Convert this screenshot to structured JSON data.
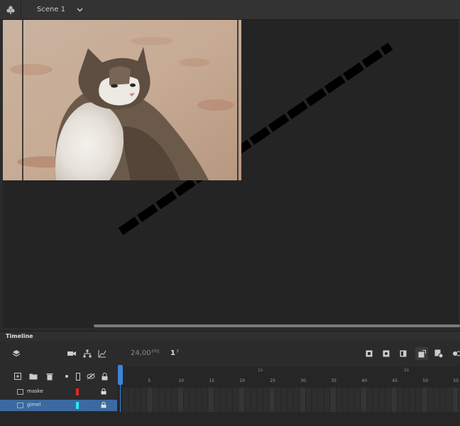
{
  "topbar": {
    "scene_label": "Scene 1"
  },
  "timeline": {
    "title": "Timeline",
    "fps_value": "24,00",
    "fps_unit": "FPS",
    "frame_value": "1",
    "frame_unit": "F",
    "second_markers": [
      "1s",
      "2s"
    ],
    "frame_ticks": [
      "5",
      "10",
      "15",
      "20",
      "25",
      "30",
      "35",
      "40",
      "45",
      "50",
      "55"
    ]
  },
  "layers": [
    {
      "name": "maske",
      "color": "#e3262a",
      "selected": false
    },
    {
      "name": "gimel",
      "color": "#2ee6f0",
      "selected": true
    }
  ],
  "colors": {
    "playhead": "#3a86d8",
    "selected_layer": "#3b6aa0"
  }
}
